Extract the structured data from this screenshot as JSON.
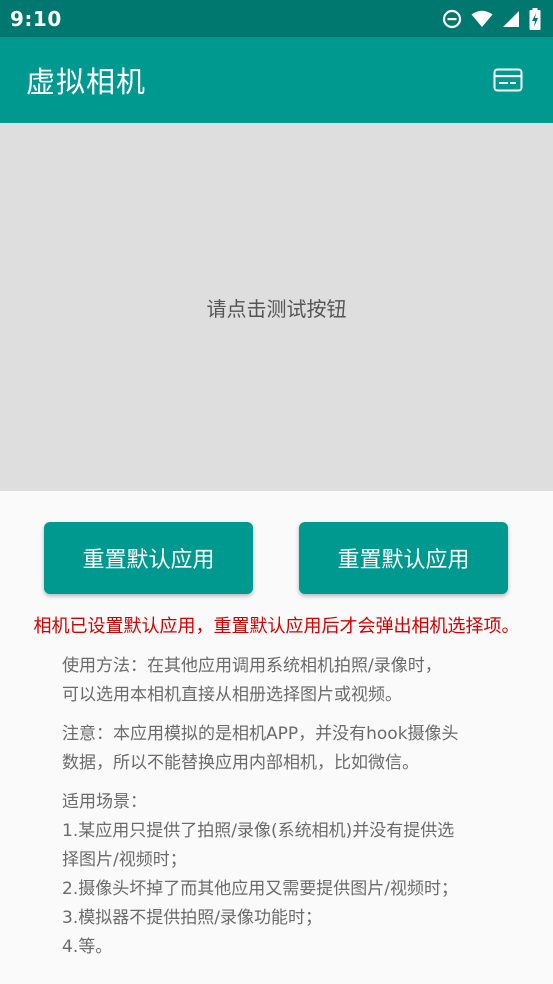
{
  "status_bar": {
    "time": "9:10",
    "icons": [
      "do-not-disturb-icon",
      "wifi-icon",
      "signal-icon",
      "battery-charging-icon"
    ]
  },
  "app_bar": {
    "title": "虚拟相机",
    "action_icon": "card-icon",
    "color": "#009990"
  },
  "preview": {
    "hint": "请点击测试按钮"
  },
  "buttons": {
    "left_label": "重置默认应用",
    "right_label": "重置默认应用"
  },
  "warning": "相机已设置默认应用，重置默认应用后才会弹出相机选择项。",
  "usage": {
    "lines": [
      "使用方法：在其他应用调用系统相机拍照/录像时，",
      "可以选用本相机直接从相册选择图片或视频。"
    ]
  },
  "note": {
    "lines": [
      "注意：本应用模拟的是相机APP，并没有hook摄像头",
      "数据，所以不能替换应用内部相机，比如微信。"
    ]
  },
  "scenes": {
    "lines": [
      "适用场景：",
      "1.某应用只提供了拍照/录像(系统相机)并没有提供选",
      "择图片/视频时；",
      "2.摄像头坏掉了而其他应用又需要提供图片/视频时；",
      "3.模拟器不提供拍照/录像功能时；",
      "4.等。"
    ]
  }
}
